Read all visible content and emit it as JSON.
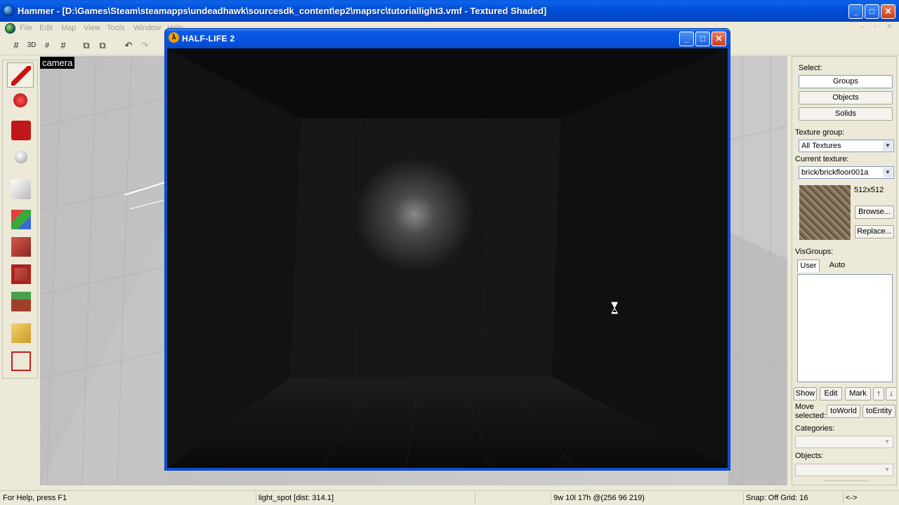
{
  "window": {
    "title": "Hammer - [D:\\Games\\Steam\\steamapps\\undeadhawk\\sourcesdk_content\\ep2\\mapsrc\\tutoriallight3.vmf - Textured Shaded]",
    "minimize": "_",
    "maximize": "□",
    "close": "✕"
  },
  "menu": {
    "items": [
      "File",
      "Edit",
      "Map",
      "View",
      "Tools",
      "Window",
      "Help"
    ]
  },
  "toolbar": {
    "icons": [
      "grid-toggle-icon",
      "grid-3d-icon",
      "grid-smaller-icon",
      "grid-larger-icon",
      "group-icon",
      "ungroup-icon",
      "undo-icon",
      "redo-icon"
    ]
  },
  "viewport": {
    "camera_label": "camera"
  },
  "game_window": {
    "title": "HALF-LIFE 2",
    "icon_glyph": "λ"
  },
  "right_panel": {
    "select_label": "Select:",
    "select_buttons": [
      "Groups",
      "Objects",
      "Solids"
    ],
    "texture_group_label": "Texture group:",
    "texture_group_value": "All Textures",
    "current_texture_label": "Current texture:",
    "current_texture_value": "brick/brickfloor001a",
    "texture_size": "512x512",
    "browse": "Browse...",
    "replace": "Replace...",
    "visgroups_label": "VisGroups:",
    "vis_tabs": [
      "User",
      "Auto"
    ],
    "vis_buttons": [
      "Show",
      "Edit",
      "Mark"
    ],
    "move_selected_line1": "Move",
    "move_selected_line2": "selected:",
    "to_world": "toWorld",
    "to_entity": "toEntity",
    "categories_label": "Categories:",
    "objects_label": "Objects:"
  },
  "status": {
    "help": "For Help, press F1",
    "selection": "light_spot  [dist: 314.1]",
    "size": "9w 10l 17h @(256 96 219)",
    "snap": "Snap: Off Grid: 16",
    "arrows": "<->"
  }
}
